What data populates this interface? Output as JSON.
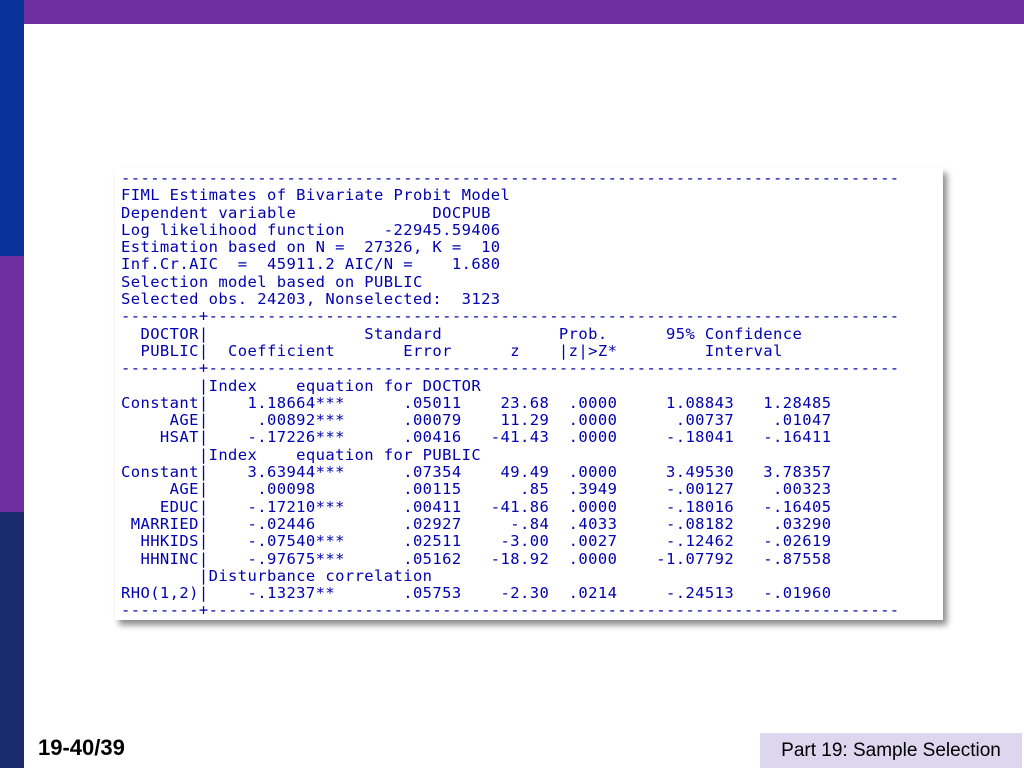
{
  "slide": {
    "page_number": "19-40/39",
    "footer_label": "Part 19: Sample Selection"
  },
  "output": {
    "rule": "--------------------------------------------------------------------------------",
    "rule_plus": "--------+-----------------------------------------------------------------------",
    "header_lines": [
      "FIML Estimates of Bivariate Probit Model",
      "Dependent variable              DOCPUB",
      "Log likelihood function    -22945.59406",
      "Estimation based on N =  27326, K =  10",
      "Inf.Cr.AIC  =  45911.2 AIC/N =    1.680",
      "Selection model based on PUBLIC",
      "Selected obs. 24203, Nonselected:  3123"
    ],
    "column_header_lines": [
      "  DOCTOR|                Standard            Prob.      95% Confidence",
      "  PUBLIC|  Coefficient       Error      z    |z|>Z*         Interval"
    ],
    "table_lines": [
      "        |Index    equation for DOCTOR",
      "Constant|    1.18664***      .05011    23.68  .0000     1.08843   1.28485",
      "     AGE|     .00892***      .00079    11.29  .0000      .00737    .01047",
      "    HSAT|    -.17226***      .00416   -41.43  .0000     -.18041   -.16411",
      "        |Index    equation for PUBLIC",
      "Constant|    3.63944***      .07354    49.49  .0000     3.49530   3.78357",
      "     AGE|     .00098         .00115      .85  .3949     -.00127    .00323",
      "    EDUC|    -.17210***      .00411   -41.86  .0000     -.18016   -.16405",
      " MARRIED|    -.02446         .02927     -.84  .4033     -.08182    .03290",
      "  HHKIDS|    -.07540***      .02511    -3.00  .0027     -.12462   -.02619",
      "  HHNINC|    -.97675***      .05162   -18.92  .0000    -1.07792   -.87558",
      "        |Disturbance correlation",
      "RHO(1,2)|    -.13237**       .05753    -2.30  .0214     -.24513   -.01960"
    ]
  }
}
